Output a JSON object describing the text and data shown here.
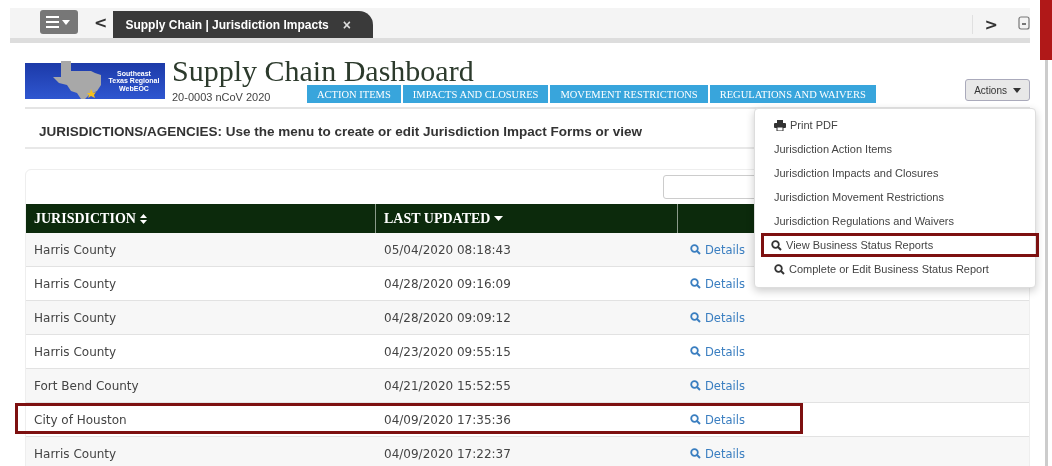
{
  "tab_bar": {
    "tab": {
      "title": "Supply Chain | Jurisdiction Impacts",
      "close": "×"
    },
    "back": "<",
    "forward": ">"
  },
  "header": {
    "logo_text": "Southeast Texas Regional WebEOC",
    "title": "Supply Chain Dashboard",
    "subtitle": "20-0003 nCoV 2020",
    "nav": [
      "ACTION ITEMS",
      "IMPACTS AND CLOSURES",
      "MOVEMENT RESTRICTIONS",
      "REGULATIONS AND WAIVERS"
    ],
    "actions_button": "Actions"
  },
  "instructions": "JURISDICTIONS/AGENCIES: Use the menu to create or edit Jurisdiction Impact Forms or view",
  "actions_menu": [
    {
      "kind": "print",
      "label": "Print PDF",
      "highlighted": false
    },
    {
      "kind": "plain",
      "label": "Jurisdiction Action Items",
      "highlighted": false
    },
    {
      "kind": "plain",
      "label": "Jurisdiction Impacts and Closures",
      "highlighted": false
    },
    {
      "kind": "plain",
      "label": "Jurisdiction Movement Restrictions",
      "highlighted": false
    },
    {
      "kind": "plain",
      "label": "Jurisdiction Regulations and Waivers",
      "highlighted": false
    },
    {
      "kind": "search",
      "label": "View Business Status Reports",
      "highlighted": true
    },
    {
      "kind": "search",
      "label": "Complete or Edit Business Status Report",
      "highlighted": false
    }
  ],
  "table": {
    "columns": [
      {
        "label": "JURISDICTION",
        "kind": "sortable"
      },
      {
        "label": "LAST UPDATED",
        "kind": "sorted_desc"
      }
    ],
    "rows": [
      {
        "jurisdiction": "Harris County",
        "last_updated": "05/04/2020 08:18:43",
        "link": "Details",
        "highlighted": false
      },
      {
        "jurisdiction": "Harris County",
        "last_updated": "04/28/2020 09:16:09",
        "link": "Details",
        "highlighted": false
      },
      {
        "jurisdiction": "Harris County",
        "last_updated": "04/28/2020 09:09:12",
        "link": "Details",
        "highlighted": false
      },
      {
        "jurisdiction": "Harris County",
        "last_updated": "04/23/2020 09:55:15",
        "link": "Details",
        "highlighted": false
      },
      {
        "jurisdiction": "Fort Bend County",
        "last_updated": "04/21/2020 15:52:55",
        "link": "Details",
        "highlighted": false
      },
      {
        "jurisdiction": "City of Houston",
        "last_updated": "04/09/2020 17:35:36",
        "link": "Details",
        "highlighted": true
      },
      {
        "jurisdiction": "Harris County",
        "last_updated": "04/09/2020 17:22:37",
        "link": "Details",
        "highlighted": false
      }
    ]
  }
}
